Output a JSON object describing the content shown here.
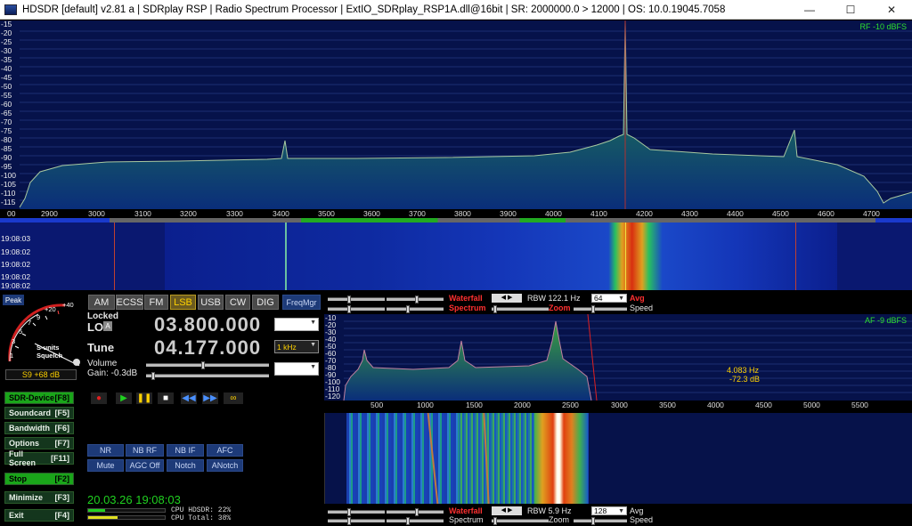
{
  "window": {
    "title": "HDSDR  [default]  v2.81 a  |  SDRplay RSP  |  Radio Spectrum Processor  |  ExtIO_SDRplay_RSP1A.dll@16bit  |  SR: 2000000.0 > 12000  |  OS: 10.0.19045.7058"
  },
  "rf_spectrum": {
    "level_label": "RF -10 dBFS",
    "y_labels": [
      "-15",
      "-20",
      "-25",
      "-30",
      "-35",
      "-40",
      "-45",
      "-50",
      "-55",
      "-60",
      "-65",
      "-70",
      "-75",
      "-80",
      "-85",
      "-90",
      "-95",
      "-100",
      "-105",
      "-110",
      "-115"
    ],
    "x_labels": [
      "00",
      "2900",
      "3000",
      "3100",
      "3200",
      "3300",
      "3400",
      "3500",
      "3600",
      "3700",
      "3800",
      "3900",
      "4000",
      "4100",
      "4200",
      "4300",
      "4400",
      "4500",
      "4600",
      "4700"
    ]
  },
  "rf_waterfall": {
    "times": [
      "19:08:03",
      "19:08:02",
      "19:08:02",
      "19:08:02",
      "19:08:02",
      "19:08:01"
    ]
  },
  "smeter": {
    "peak": "Peak",
    "scale": [
      "+20",
      "+40",
      "3",
      "5",
      "7",
      "9",
      "1"
    ],
    "caption1": "S-units",
    "caption2": "Squelch",
    "reading": "S9 +68 dB"
  },
  "modes": [
    {
      "label": "AM"
    },
    {
      "label": "ECSS"
    },
    {
      "label": "FM"
    },
    {
      "label": "LSB"
    },
    {
      "label": "USB"
    },
    {
      "label": "CW"
    },
    {
      "label": "DIG"
    },
    {
      "label": "FreqMgr"
    }
  ],
  "lo": {
    "locked": "Locked",
    "label": "LO",
    "badge": "A",
    "freq": "03.800.000"
  },
  "tune": {
    "label": "Tune",
    "freq": "04.177.000",
    "step": "1 kHz"
  },
  "volume": {
    "label": "Volume",
    "gain": "Gain: -0.3dB"
  },
  "side_buttons": [
    {
      "label": "SDR-Device",
      "key": "[F8]"
    },
    {
      "label": "Soundcard",
      "key": "[F5]"
    },
    {
      "label": "Bandwidth",
      "key": "[F6]"
    },
    {
      "label": "Options",
      "key": "[F7]"
    },
    {
      "label": "Full Screen",
      "key": "[F11]"
    },
    {
      "label": "Stop",
      "key": "[F2]"
    },
    {
      "label": "Minimize",
      "key": "[F3]"
    },
    {
      "label": "Exit",
      "key": "[F4]"
    }
  ],
  "dsp_buttons": [
    {
      "label": "NR"
    },
    {
      "label": "NB RF"
    },
    {
      "label": "NB IF"
    },
    {
      "label": "AFC"
    },
    {
      "label": "Mute"
    },
    {
      "label": "AGC Off"
    },
    {
      "label": "Notch"
    },
    {
      "label": "ANotch"
    }
  ],
  "clock": "20.03.26 19:08:03",
  "cpu": {
    "hdsdr": "CPU HDSDR:  22%",
    "total": "CPU Total:  38%",
    "hdsdr_fraction": 0.22,
    "total_fraction": 0.38
  },
  "rf_controls": {
    "waterfall": "Waterfall",
    "spectrum": "Spectrum",
    "rbw": "RBW  122.1 Hz",
    "fft": "64",
    "avg": "Avg",
    "zoom": "Zoom",
    "speed": "Speed"
  },
  "af_spectrum": {
    "level_label": "AF -9 dBFS",
    "y_labels": [
      "-10",
      "-20",
      "-30",
      "-40",
      "-50",
      "-60",
      "-70",
      "-80",
      "-90",
      "-100",
      "-110",
      "-120"
    ],
    "x_labels": [
      "500",
      "1000",
      "1500",
      "2000",
      "2500",
      "3000",
      "3500",
      "4000",
      "4500",
      "5000",
      "5500"
    ],
    "cursor_freq": "4.083 Hz",
    "cursor_db": "-72.3 dB"
  },
  "af_controls": {
    "waterfall": "Waterfall",
    "spectrum": "Spectrum",
    "rbw": "RBW   5.9 Hz",
    "fft": "128",
    "avg": "Avg",
    "zoom": "Zoom",
    "speed": "Speed"
  },
  "colors": {
    "accent": "#ffd200",
    "panel": "#06124a",
    "red": "#ff3030",
    "green": "#1aa51a"
  }
}
